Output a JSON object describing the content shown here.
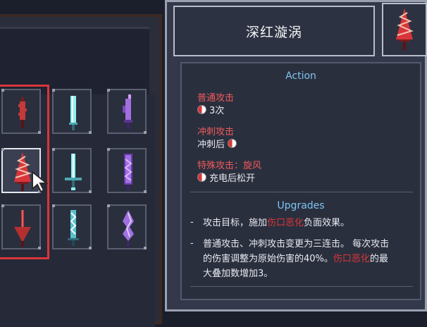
{
  "weapon": {
    "name": "深红漩涡"
  },
  "sections": {
    "action_title": "Action",
    "upgrades_title": "Upgrades"
  },
  "actions": [
    {
      "label": "普通攻击",
      "value": "3次",
      "pip_position": "before"
    },
    {
      "label": "冲刺攻击",
      "value": "冲刺后",
      "pip_position": "after"
    },
    {
      "label": "特殊攻击：旋风",
      "value": "充电后松开",
      "pip_position": "before"
    }
  ],
  "upgrades": [
    {
      "bullet": "-",
      "line1_parts": [
        "攻击目标，施加",
        "伤口恶化",
        "负面效果。"
      ]
    },
    {
      "bullet": "-",
      "line1": "普通攻击、冲刺攻击变更为三连击。 每次攻击",
      "line2_parts": [
        "的伤害调整为原始伤害的40%。",
        "伤口恶化",
        "的最"
      ],
      "line3": "大叠加数增加3。"
    }
  ],
  "colors": {
    "highlight_red": "#d8363a",
    "section_blue": "#7fc4f2",
    "selection_outline": "#d8363a"
  },
  "inventory": {
    "selected_slot": "row-2-col-1",
    "slots": [
      {
        "row": 1,
        "col": 1,
        "icon": "crimson-spike-dagger-icon",
        "color": "#c43a3a"
      },
      {
        "row": 1,
        "col": 2,
        "icon": "cyan-crystal-blade-icon",
        "color": "#8ff0f0"
      },
      {
        "row": 1,
        "col": 3,
        "icon": "purple-ornate-blade-icon",
        "color": "#a070e0"
      },
      {
        "row": 2,
        "col": 1,
        "icon": "crimson-vortex-sword-icon",
        "color": "#d8363a"
      },
      {
        "row": 2,
        "col": 2,
        "icon": "cyan-longsword-icon",
        "color": "#8ff0f0"
      },
      {
        "row": 2,
        "col": 3,
        "icon": "purple-crystal-sword-icon",
        "color": "#a070e0"
      },
      {
        "row": 3,
        "col": 1,
        "icon": "crimson-broadsword-icon",
        "color": "#b43030"
      },
      {
        "row": 3,
        "col": 2,
        "icon": "cyan-rune-sword-icon",
        "color": "#8ff0f0"
      },
      {
        "row": 3,
        "col": 3,
        "icon": "purple-flame-blade-icon",
        "color": "#a070e0"
      }
    ]
  }
}
